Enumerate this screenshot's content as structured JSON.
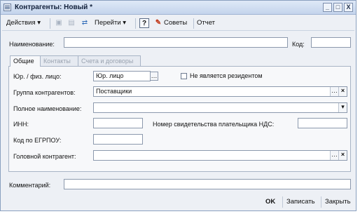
{
  "window": {
    "title": "Контрагенты: Новый *"
  },
  "toolbar": {
    "actions_label": "Действия",
    "goto_label": "Перейти",
    "help_label": "?",
    "tips_label": "Советы",
    "report_label": "Отчет"
  },
  "header": {
    "name_label": "Наименование:",
    "name_value": "",
    "code_label": "Код:",
    "code_value": ""
  },
  "tabs": [
    "Общие",
    "Контакты",
    "Счета и договоры"
  ],
  "form": {
    "legal_label": "Юр. / физ. лицо:",
    "legal_value": "Юр. лицо",
    "nonresident_label": "Не является резидентом",
    "group_label": "Группа контрагентов:",
    "group_value": "Поставщики",
    "fullname_label": "Полное наименование:",
    "fullname_value": "",
    "inn_label": "ИНН:",
    "inn_value": "",
    "vat_label": "Номер свидетельства плательщика НДС:",
    "vat_value": "",
    "egrpou_label": "Код по ЕГРПОУ:",
    "egrpou_value": "",
    "head_label": "Головной контрагент:",
    "head_value": ""
  },
  "comment": {
    "label": "Комментарий:",
    "value": ""
  },
  "buttons": {
    "ok": "OK",
    "save": "Записать",
    "close": "Закрыть"
  },
  "window_buttons": {
    "minimize": "_",
    "maximize": "□",
    "close": "X"
  }
}
